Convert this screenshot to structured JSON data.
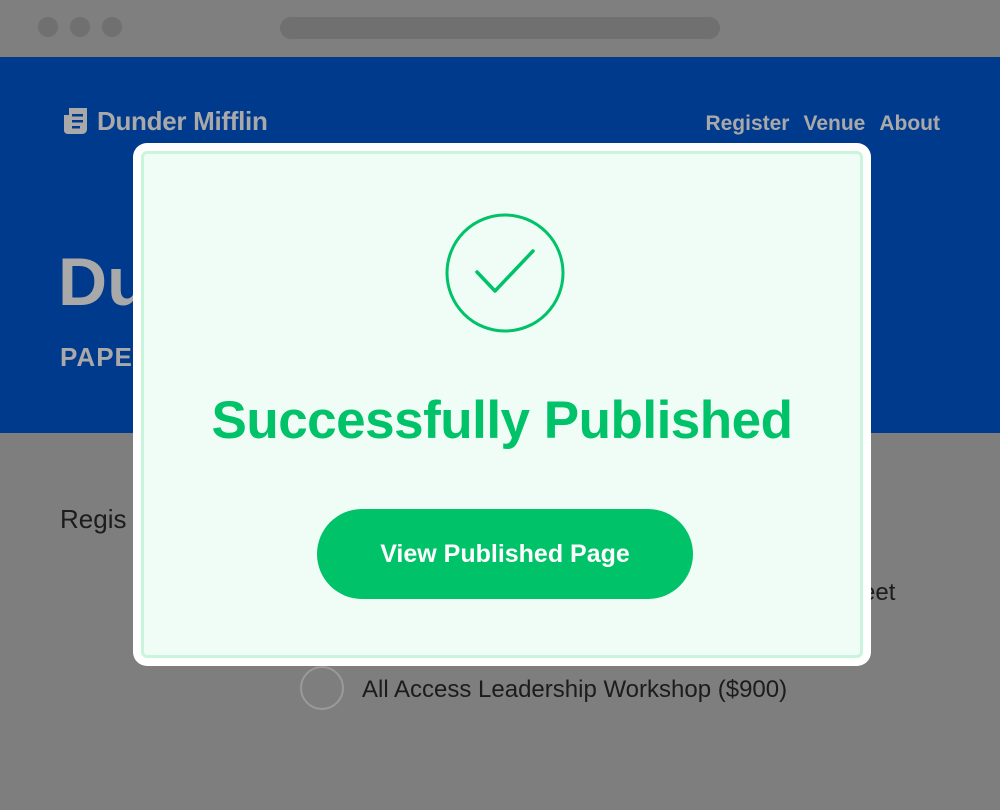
{
  "site": {
    "brand": "Dunder Mifflin",
    "nav": [
      "Register",
      "Venue",
      "About"
    ],
    "hero_title": "Du",
    "hero_subtitle": "PAPE"
  },
  "form": {
    "section_label_partial": "Regis",
    "option_partial_tail": "eet",
    "option_label": "All Access Leadership Workshop ($900)"
  },
  "modal": {
    "title": "Successfully Published",
    "button_label": "View Published Page"
  },
  "icons": {
    "brand_logo": "document-stack-icon",
    "success": "check-circle-icon"
  },
  "colors": {
    "hero_bg": "#003a8c",
    "success": "#00c268",
    "modal_bg": "#f0fcf6",
    "overlay": "#7e7e7e"
  }
}
